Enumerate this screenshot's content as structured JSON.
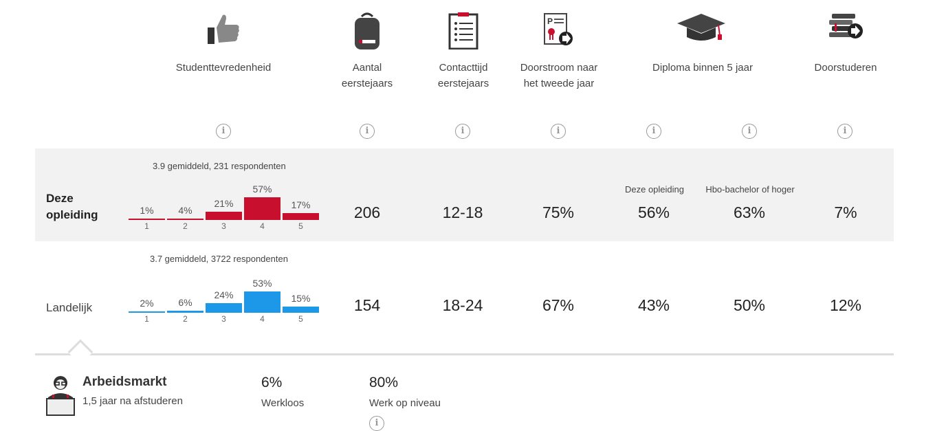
{
  "headers": [
    {
      "label": "Studenttevredenheid",
      "icon": "thumbs-up-icon"
    },
    {
      "label": "Aantal eerstejaars",
      "icon": "backpack-icon"
    },
    {
      "label": "Contacttijd eerstejaars",
      "icon": "clipboard-list-icon"
    },
    {
      "label": "Doorstroom naar het tweede jaar",
      "icon": "certificate-arrow-icon"
    },
    {
      "label": "Diploma binnen 5 jaar",
      "icon": "graduation-cap-icon"
    },
    {
      "label": "Doorstuderen",
      "icon": "books-arrow-icon"
    }
  ],
  "diploma_sub": {
    "this": "Deze opleiding",
    "hbo": "Hbo-bachelor of hoger"
  },
  "rows": [
    {
      "label": "Deze opleiding",
      "summary": "3.9 gemiddeld, 231 respondenten",
      "color": "#c8102e",
      "dist": [
        {
          "n": "1",
          "pct": "1%",
          "v": 1
        },
        {
          "n": "2",
          "pct": "4%",
          "v": 4
        },
        {
          "n": "3",
          "pct": "21%",
          "v": 21
        },
        {
          "n": "4",
          "pct": "57%",
          "v": 57
        },
        {
          "n": "5",
          "pct": "17%",
          "v": 17
        }
      ],
      "eerstejaars": "206",
      "contacttijd": "12-18",
      "doorstroom": "75%",
      "diploma_this": "56%",
      "diploma_hbo": "63%",
      "doorstuderen": "7%"
    },
    {
      "label": "Landelijk",
      "summary": "3.7 gemiddeld, 3722 respondenten",
      "color": "#1d97e8",
      "dist": [
        {
          "n": "1",
          "pct": "2%",
          "v": 2
        },
        {
          "n": "2",
          "pct": "6%",
          "v": 6
        },
        {
          "n": "3",
          "pct": "24%",
          "v": 24
        },
        {
          "n": "4",
          "pct": "53%",
          "v": 53
        },
        {
          "n": "5",
          "pct": "15%",
          "v": 15
        }
      ],
      "eerstejaars": "154",
      "contacttijd": "18-24",
      "doorstroom": "67%",
      "diploma_this": "43%",
      "diploma_hbo": "50%",
      "doorstuderen": "12%"
    }
  ],
  "arbeidsmarkt": {
    "title": "Arbeidsmarkt",
    "subtitle": "1,5 jaar na afstuderen",
    "werkloos_value": "6%",
    "werkloos_label": "Werkloos",
    "niveau_value": "80%",
    "niveau_label": "Werk op niveau"
  },
  "info_glyph": "i"
}
